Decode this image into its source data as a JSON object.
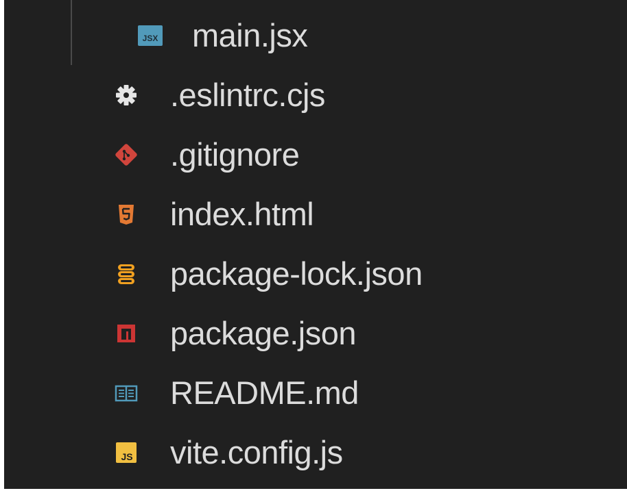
{
  "explorer": {
    "files": [
      {
        "name": "main.jsx",
        "icon": "react-jsx-icon",
        "nested": true
      },
      {
        "name": ".eslintrc.cjs",
        "icon": "gear-icon",
        "nested": false
      },
      {
        "name": ".gitignore",
        "icon": "git-icon",
        "nested": false
      },
      {
        "name": "index.html",
        "icon": "html5-icon",
        "nested": false
      },
      {
        "name": "package-lock.json",
        "icon": "database-icon",
        "nested": false
      },
      {
        "name": "package.json",
        "icon": "npm-icon",
        "nested": false
      },
      {
        "name": "README.md",
        "icon": "book-icon",
        "nested": false
      },
      {
        "name": "vite.config.js",
        "icon": "javascript-icon",
        "nested": false
      }
    ],
    "icon_texts": {
      "jsx": "JSX",
      "js": "JS"
    },
    "colors": {
      "background": "#202020",
      "text": "#dcdcdc",
      "jsx_icon": "#519aba",
      "gear_icon": "#e6e6e6",
      "git_icon": "#d0453c",
      "html_icon": "#e37933",
      "json_lock_icon": "#f0a020",
      "npm_icon": "#cc3534",
      "readme_icon": "#519aba",
      "js_icon": "#f1bf41"
    }
  }
}
